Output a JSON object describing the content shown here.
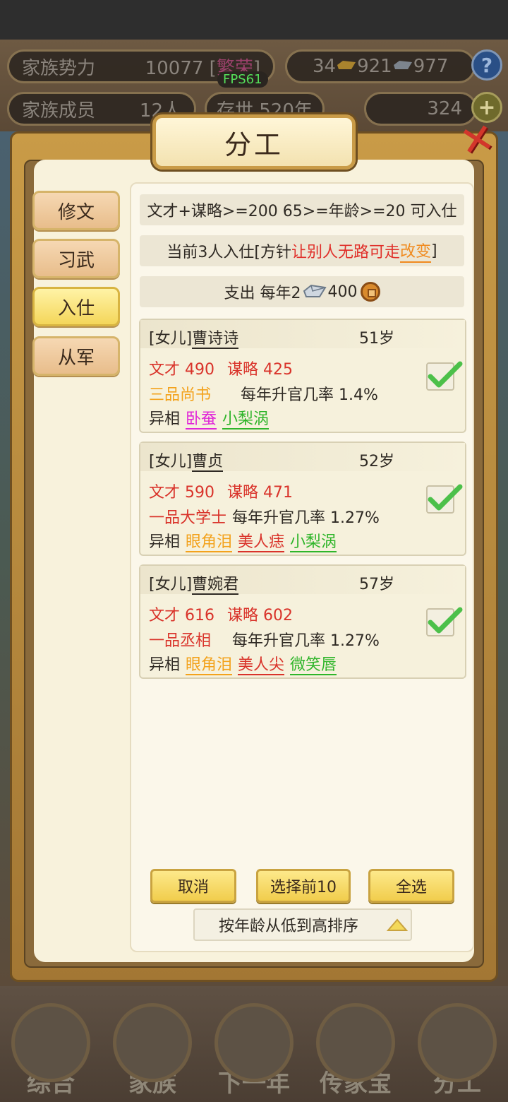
{
  "hud": {
    "clan_power_label": "家族势力",
    "clan_power_value": "10077 [",
    "clan_power_tag": "繁荣",
    "clan_power_close": "]",
    "currency_a": "34",
    "currency_b": "921",
    "currency_c": "977",
    "fps": "FPS61",
    "members_label": "家族成员",
    "members_value": "12人",
    "alive_text": "存世 520年",
    "gold_value": "324"
  },
  "dialog": {
    "title": "分工",
    "tabs": [
      {
        "label": "修文",
        "active": false
      },
      {
        "label": "习武",
        "active": false
      },
      {
        "label": "入仕",
        "active": true
      },
      {
        "label": "从军",
        "active": false
      }
    ],
    "requirement": "文才+谋略>=200 65>=年龄>=20 可入仕",
    "policy_prefix": "当前3人入仕[方针",
    "policy_name": "让别人无路可走",
    "policy_change": "改变",
    "policy_suffix": "]",
    "cost_prefix": "支出 每年2",
    "cost_value": "400",
    "members": [
      {
        "relation": "[女儿]",
        "name": "曹诗诗",
        "age": "51岁",
        "wencai": "文才 490",
        "moulue": "谋略 425",
        "rank": "三品尚书",
        "rank_color": "#f3a21c",
        "promo_rate": "每年升官几率 1.4%",
        "traits_label": "异相",
        "traits": [
          {
            "text": "卧蚕",
            "color": "#e026d8"
          },
          {
            "text": "小梨涡",
            "color": "#2fb52a"
          }
        ],
        "checked": true
      },
      {
        "relation": "[女儿]",
        "name": "曹贞",
        "age": "52岁",
        "wencai": "文才 590",
        "moulue": "谋略 471",
        "rank": "一品大学士",
        "rank_color": "#d9332a",
        "promo_rate": "每年升官几率 1.27%",
        "traits_label": "异相",
        "traits": [
          {
            "text": "眼角泪",
            "color": "#f3a21c"
          },
          {
            "text": "美人痣",
            "color": "#d9332a"
          },
          {
            "text": "小梨涡",
            "color": "#2fb52a"
          }
        ],
        "checked": true
      },
      {
        "relation": "[女儿]",
        "name": "曹婉君",
        "age": "57岁",
        "wencai": "文才 616",
        "moulue": "谋略 602",
        "rank": "一品丞相",
        "rank_color": "#d9332a",
        "promo_rate": "每年升官几率 1.27%",
        "traits_label": "异相",
        "traits": [
          {
            "text": "眼角泪",
            "color": "#f3a21c"
          },
          {
            "text": "美人尖",
            "color": "#d9332a"
          },
          {
            "text": "微笑唇",
            "color": "#2fb52a"
          }
        ],
        "checked": true
      }
    ],
    "buttons": {
      "cancel": "取消",
      "select_top10": "选择前10",
      "select_all": "全选"
    },
    "sort_label": "按年龄从低到高排序"
  },
  "bottom_nav": [
    {
      "label": "综合",
      "icon": "scroll-icon"
    },
    {
      "label": "家族",
      "icon": "house-icon"
    },
    {
      "label": "下一年",
      "icon": "mountain-icon"
    },
    {
      "label": "传家宝",
      "icon": "treasure-icon"
    },
    {
      "label": "分工",
      "icon": "person-icon"
    }
  ]
}
